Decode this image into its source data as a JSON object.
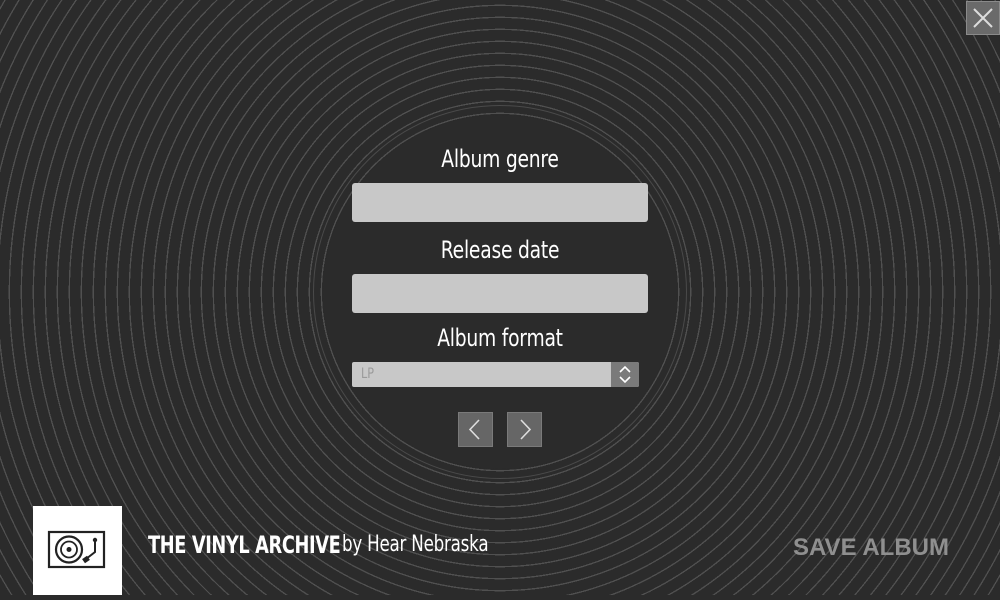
{
  "form": {
    "genre_label": "Album genre",
    "genre_value": "",
    "release_label": "Release date",
    "release_value": "",
    "format_label": "Album format",
    "format_value": "LP"
  },
  "footer": {
    "title": "THE VINYL ARCHIVE",
    "byline": "by Hear Nebraska",
    "save_label": "SAVE ALBUM"
  },
  "icons": {
    "close": "close-icon",
    "prev": "chevron-left-icon",
    "next": "chevron-right-icon",
    "logo": "turntable-icon",
    "spinner": "spinner-arrows-icon"
  },
  "colors": {
    "background": "#2b2b2b",
    "input": "#c8c8c8",
    "button": "#666666",
    "save_text": "#8f8f8f"
  }
}
